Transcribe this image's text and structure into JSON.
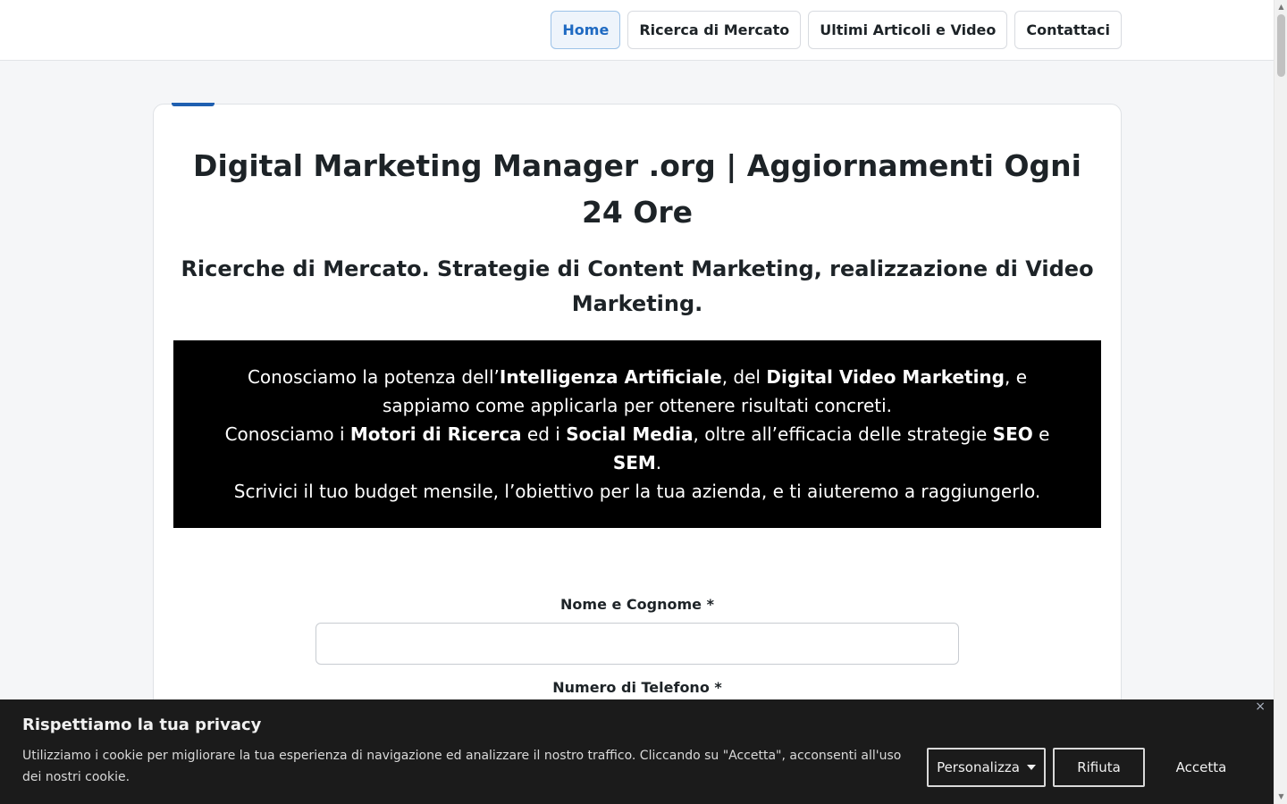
{
  "nav": {
    "items": [
      {
        "label": "Home",
        "active": true
      },
      {
        "label": "Ricerca di Mercato",
        "active": false
      },
      {
        "label": "Ultimi Articoli e Video",
        "active": false
      },
      {
        "label": "Contattaci",
        "active": false
      }
    ]
  },
  "main": {
    "title": "Digital Marketing Manager .org | Aggiornamenti Ogni 24 Ore",
    "subtitle": "Ricerche di Mercato. Strategie di Content Marketing, realizzazione di Video Marketing.",
    "promo": {
      "line1_a": "Conosciamo la potenza dell’",
      "line1_b": "Intelligenza Artificiale",
      "line1_c": ", del ",
      "line1_d": "Digital Video Marketing",
      "line1_e": ", e sappiamo come applicarla per ottenere risultati concreti.",
      "line2_a": "Conosciamo i ",
      "line2_b": "Motori di Ricerca",
      "line2_c": " ed i ",
      "line2_d": "Social Media",
      "line2_e": ", oltre all’efficacia delle strategie ",
      "line2_f": "SEO",
      "line2_g": " e ",
      "line2_h": "SEM",
      "line2_i": ".",
      "line3": "Scrivici il tuo budget mensile, l’obiettivo per la tua azienda, e ti aiuteremo a raggiungerlo."
    },
    "form": {
      "name_label": "Nome e Cognome *",
      "name_value": "",
      "phone_label": "Numero di Telefono *"
    }
  },
  "cookie": {
    "title": "Rispettiamo la tua privacy",
    "text": "Utilizziamo i cookie per migliorare la tua esperienza di navigazione ed analizzare il nostro traffico. Cliccando su \"Accetta\", acconsenti all'uso dei nostri cookie.",
    "customize_label": "Personalizza",
    "reject_label": "Rifiuta",
    "accept_label": "Accetta",
    "close_symbol": "×"
  },
  "colors": {
    "accent": "#1f5fb0",
    "promo_bg": "#000000",
    "cookie_bg": "#1b1b1b"
  }
}
